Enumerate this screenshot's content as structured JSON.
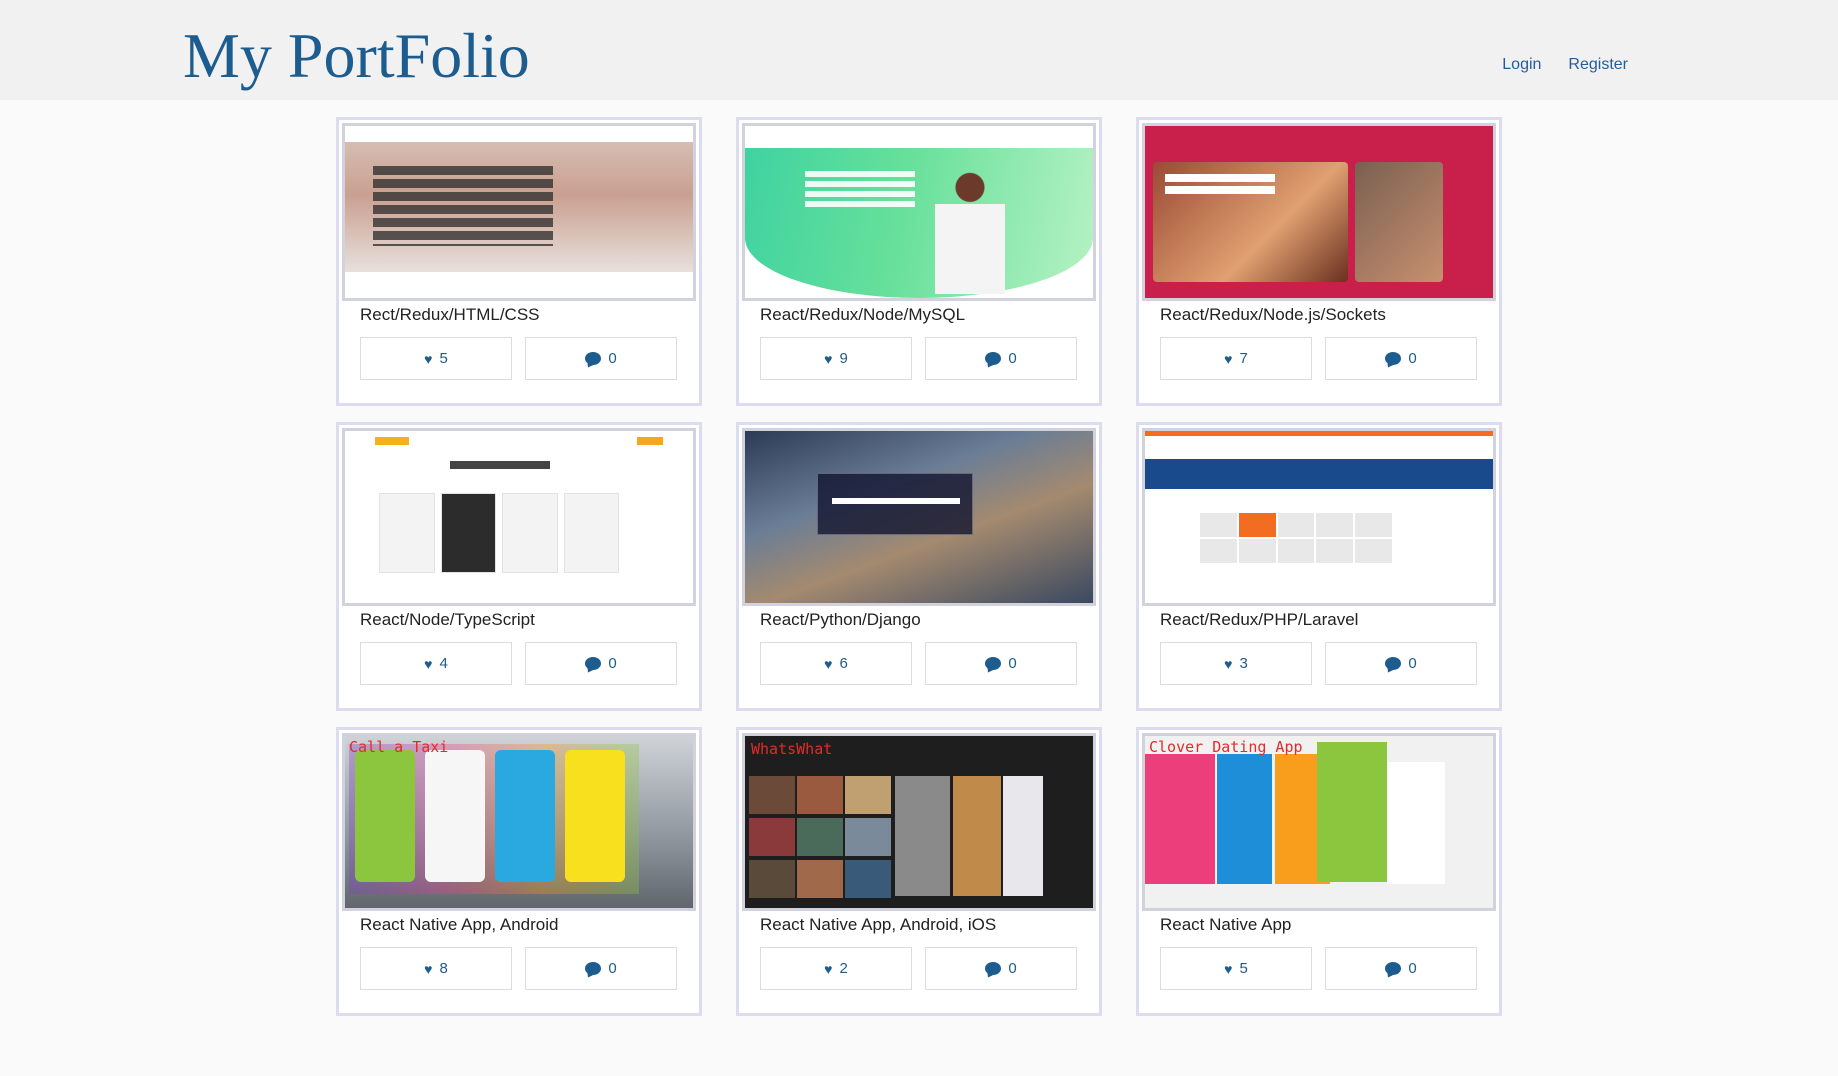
{
  "brand": {
    "title": "My PortFolio"
  },
  "nav": {
    "login": "Login",
    "register": "Register"
  },
  "projects": [
    {
      "title": "Rect/Redux/HTML/CSS",
      "likes": "5",
      "comments": "0"
    },
    {
      "title": "React/Redux/Node/MySQL",
      "likes": "9",
      "comments": "0"
    },
    {
      "title": "React/Redux/Node.js/Sockets",
      "likes": "7",
      "comments": "0"
    },
    {
      "title": "React/Node/TypeScript",
      "likes": "4",
      "comments": "0"
    },
    {
      "title": "React/Python/Django",
      "likes": "6",
      "comments": "0"
    },
    {
      "title": "React/Redux/PHP/Laravel",
      "likes": "3",
      "comments": "0"
    },
    {
      "title": "React Native App, Android",
      "likes": "8",
      "comments": "0"
    },
    {
      "title": "React Native App, Android, iOS",
      "likes": "2",
      "comments": "0"
    },
    {
      "title": "React Native App",
      "likes": "5",
      "comments": "0"
    }
  ],
  "thumbnail_captions": {
    "taxi": "Call a Taxi",
    "whatswhat": "WhatsWhat",
    "clover": "Clover Dating App"
  },
  "colors": {
    "accent": "#1d5c8e",
    "card_border": "#dcdcf0",
    "navbar": "#f1f1f1"
  },
  "icons": {
    "like": "heart-icon",
    "comment": "comment-bubble-icon"
  }
}
